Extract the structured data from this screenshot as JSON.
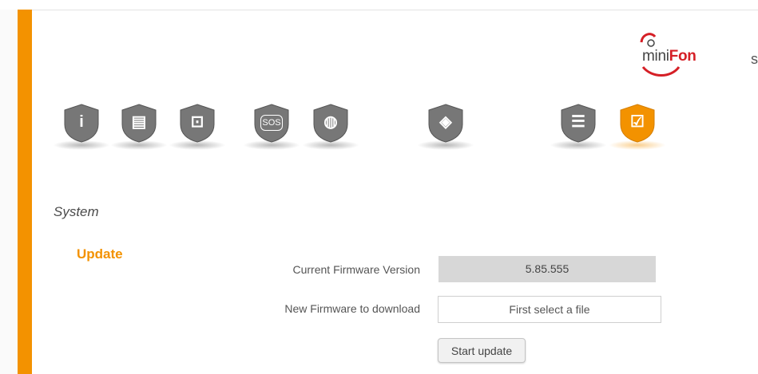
{
  "brand": {
    "logo_mini": "mini",
    "logo_fon": "Fon",
    "accent_color": "#f39200",
    "brand_red": "#d51f26"
  },
  "edge_char": "s",
  "nav_icons": [
    {
      "name": "info-icon",
      "glyph": "i",
      "active": false
    },
    {
      "name": "contact-card-icon",
      "glyph": "▤",
      "active": false
    },
    {
      "name": "phone-plug-icon",
      "glyph": "⊡",
      "active": false
    },
    {
      "name": "sos-icon",
      "glyph": "SOS",
      "active": false
    },
    {
      "name": "contacts-icon",
      "glyph": "◍",
      "active": false
    },
    {
      "name": "flame-icon",
      "glyph": "◈",
      "active": false
    },
    {
      "name": "settings-sliders-icon",
      "glyph": "☰",
      "active": false
    },
    {
      "name": "system-monitor-icon",
      "glyph": "☑",
      "active": true
    }
  ],
  "page": {
    "section_title": "System",
    "subsection_title": "Update"
  },
  "firmware": {
    "current_label": "Current Firmware Version",
    "current_value": "5.85.555",
    "new_label": "New Firmware to download",
    "file_placeholder": "First select a file",
    "start_button": "Start update"
  }
}
